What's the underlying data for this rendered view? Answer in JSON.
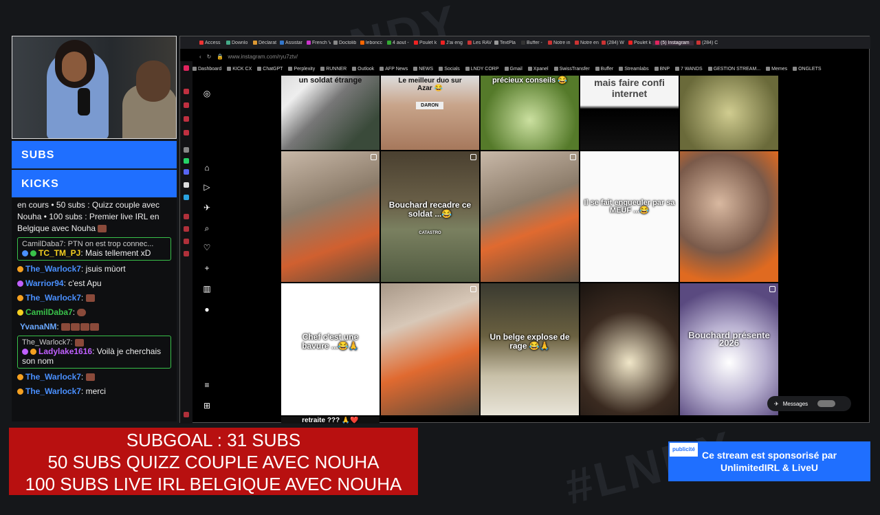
{
  "panels": {
    "subs": "SUBS",
    "kicks": "KICKS"
  },
  "chat": {
    "intro": "en cours • 50 subs : Quizz couple avec Nouha • 100 subs : Premier live IRL en Belgique avec Nouha",
    "reply1": {
      "ref": "CamilDaba7: PTN on est trop connec...",
      "name": "TC_TM_PJ",
      "text": ": Mais tellement xD"
    },
    "lines": [
      {
        "name": "The_Warlock7",
        "text": ": jsuis mùort",
        "color": "#4a90ff"
      },
      {
        "name": "Warrior94",
        "text": ": c'est Apu",
        "color": "#4a90ff"
      },
      {
        "name": "The_Warlock7",
        "text": ":",
        "color": "#4a90ff"
      },
      {
        "name": "CamilDaba7",
        "text": ":",
        "color": "#39c24a"
      },
      {
        "name": "YvanaNM",
        "text": ":",
        "color": "#6aa8ff"
      }
    ],
    "reply2": {
      "ref": "The_Warlock7:",
      "name": "Ladylake1616",
      "text": ": Voilà je cherchais son nom"
    },
    "lines2": [
      {
        "name": "The_Warlock7",
        "text": ":",
        "color": "#4a90ff"
      },
      {
        "name": "The_Warlock7",
        "text": ": merci",
        "color": "#4a90ff"
      }
    ]
  },
  "browser": {
    "tabs": [
      "Access",
      "Downlo",
      "Déclarat",
      "Assistar",
      "French V",
      "Doctolib",
      "leboncc",
      "4 aout -",
      "Poulet k",
      "J'ai eng",
      "Les RAV",
      "TextPla",
      "Buffer -",
      "Notre in",
      "Notre en",
      "(284) W",
      "Poulet k",
      "(5) Instagram",
      "(284) C"
    ],
    "url": "www.instagram.com/ryu7ztv/",
    "bookmarks": [
      "Dashboard",
      "KICK CX",
      "ChatGPT",
      "Perplexity",
      "RUNNER",
      "Outlook",
      "AFP News",
      "NEWS",
      "Socials",
      "LNDY CORP",
      "Gmail",
      "Xpanel",
      "SwissTransfer",
      "Buffer",
      "Streamlabs",
      "BNP",
      "7 WANDS",
      "GESTION STREAM...",
      "Memes",
      "ONGLETS"
    ]
  },
  "reels": [
    {
      "caption": "un soldat étrange"
    },
    {
      "caption": "Le meilleur duo sur Azar 😂",
      "sub": "DARON"
    },
    {
      "caption": "précieux conseils 😂"
    },
    {
      "caption": "mais faire confi internet"
    },
    {
      "caption": ""
    },
    {
      "caption": ""
    },
    {
      "caption": "Bouchard recadre ce soldat ...😂",
      "sub": "CATASTRO"
    },
    {
      "caption": ""
    },
    {
      "caption": "Il se fait engueuler par sa MEUF ...😂"
    },
    {
      "caption": ""
    },
    {
      "caption": "Chef c'est une bavure ...😂🙏"
    },
    {
      "caption": ""
    },
    {
      "caption": "Un belge explose de rage 😂🙏"
    },
    {
      "caption": ""
    },
    {
      "caption": "Bouchard présente 2026"
    }
  ],
  "bottom_caption": "retraite ??? 🙏❤️",
  "messages": "Messages",
  "subgoal": {
    "line1": "SUBGOAL : 31 SUBS",
    "line2": "50 SUBS QUIZZ COUPLE AVEC NOUHA",
    "line3": "100 SUBS LIVE IRL BELGIQUE AVEC NOUHA"
  },
  "ad": {
    "tag": "publicité",
    "text": "Ce stream est sponsorisé par UnlimitedIRL & LiveU"
  },
  "colors": {
    "accent": "#1f6fff",
    "subgoal": "#b81010",
    "reply_border": "#39c24a"
  }
}
